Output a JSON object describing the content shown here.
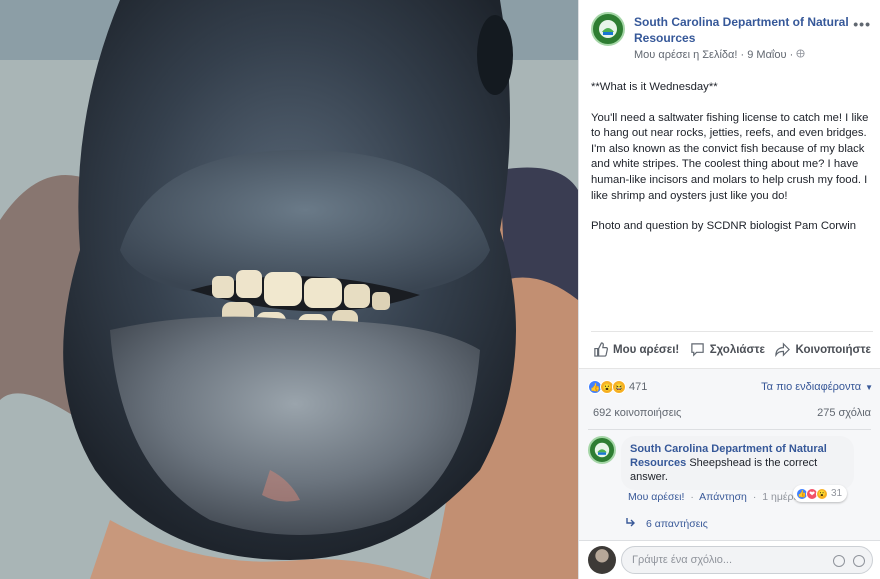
{
  "post": {
    "page_name": "South Carolina Department of Natural Resources",
    "like_page": "Μου αρέσει η Σελίδα!",
    "dot": "·",
    "date": "9 Μαΐου",
    "privacy_icon": "globe-icon",
    "paragraphs": [
      "**What is it Wednesday**",
      "You'll need a saltwater fishing license to catch me! I like to hang out near rocks, jetties, reefs, and even bridges. I'm also known as the convict fish because of my black and white stripes. The coolest thing about me? I have human-like incisors and molars to help crush my food. I like shrimp and oysters just like you do!",
      "Photo and question by SCDNR biologist Pam Corwin"
    ]
  },
  "actions": {
    "like": "Μου αρέσει!",
    "comment": "Σχολιάστε",
    "share": "Κοινοποιήστε"
  },
  "reactions": {
    "count": "471",
    "sort_label": "Τα πιο ενδιαφέροντα",
    "shares": "692 κοινοποιήσεις",
    "comments": "275 σχόλια"
  },
  "comment": {
    "author": "South Carolina Department of Natural Resources",
    "text": "Sheepshead is the correct answer.",
    "like": "Μου αρέσει!",
    "reply": "Απάντηση",
    "time": "1 ημέρα",
    "sep": "·",
    "reaction_count": "31",
    "replies_label": "6 απαντήσεις"
  },
  "composer": {
    "placeholder": "Γράψτε ένα σχόλιο..."
  },
  "colors": {
    "link": "#365899",
    "accent": "#4080ff"
  }
}
